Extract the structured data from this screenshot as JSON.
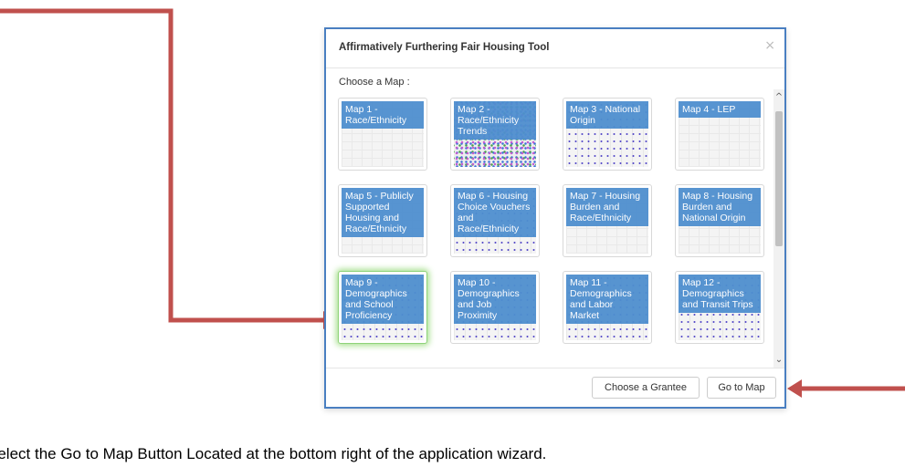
{
  "dialog": {
    "title": "Affirmatively Furthering Fair Housing Tool",
    "close": "×",
    "choose_label": "Choose a Map :",
    "maps": [
      {
        "label": "Map 1 - Race/Ethnicity",
        "thumb": "grid"
      },
      {
        "label": "Map 2 - Race/Ethnicity Trends",
        "thumb": "dense"
      },
      {
        "label": "Map 3 - National Origin",
        "thumb": "dots"
      },
      {
        "label": "Map 4 - LEP",
        "thumb": "grid"
      },
      {
        "label": "Map 5 - Publicly Supported Housing and Race/Ethnicity",
        "thumb": "grid"
      },
      {
        "label": "Map 6 - Housing Choice Vouchers and Race/Ethnicity",
        "thumb": "dots"
      },
      {
        "label": "Map 7 - Housing Burden and Race/Ethnicity",
        "thumb": "grid"
      },
      {
        "label": "Map 8 - Housing Burden and National Origin",
        "thumb": "grid"
      },
      {
        "label": "Map 9 - Demographics and School Proficiency",
        "thumb": "dots",
        "selected": true
      },
      {
        "label": "Map 10 - Demographics and Job Proximity",
        "thumb": "dots"
      },
      {
        "label": "Map 11 - Demographics and Labor Market",
        "thumb": "dots"
      },
      {
        "label": "Map 12 - Demographics and Transit Trips",
        "thumb": "dots"
      }
    ],
    "scroll_up": "^",
    "scroll_down": "⌄",
    "buttons": {
      "choose_grantee": "Choose a Grantee",
      "go_to_map": "Go to Map"
    }
  },
  "caption": "Select the Go to Map Button Located at the bottom right of the application wizard.",
  "colors": {
    "arrow": "#c0504d",
    "dialog_border": "#4a7fc1",
    "tile_label_bg": "#4f8fcf",
    "selected_glow": "#a8e08f"
  }
}
